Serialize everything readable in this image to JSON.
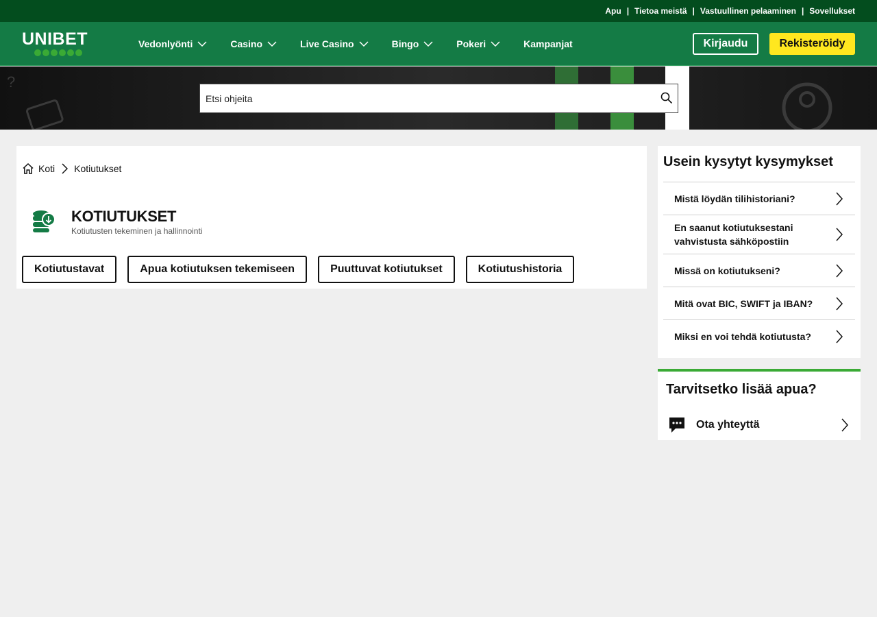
{
  "top_links": [
    "Apu",
    "Tietoa meistä",
    "Vastuullinen pelaaminen",
    "Sovellukset"
  ],
  "top_separator": "|",
  "logo": {
    "text": "UNIBET"
  },
  "nav": {
    "items": [
      {
        "label": "Vedonlyönti",
        "dropdown": true
      },
      {
        "label": "Casino",
        "dropdown": true
      },
      {
        "label": "Live Casino",
        "dropdown": true
      },
      {
        "label": "Bingo",
        "dropdown": true
      },
      {
        "label": "Pokeri",
        "dropdown": true
      },
      {
        "label": "Kampanjat",
        "dropdown": false
      }
    ],
    "login_label": "Kirjaudu",
    "register_label": "Rekisteröidy"
  },
  "search": {
    "placeholder": "Etsi ohjeita",
    "icon": "search-icon"
  },
  "breadcrumb": {
    "home": "Koti",
    "current": "Kotiutukset"
  },
  "page": {
    "title": "KOTIUTUKSET",
    "subtitle": "Kotiutusten tekeminen ja hallinnointi",
    "icon": "coins-download-icon"
  },
  "tabs": [
    "Kotiutustavat",
    "Apua kotiutuksen tekemiseen",
    "Puuttuvat kotiutukset",
    "Kotiutushistoria"
  ],
  "faq": {
    "title": "Usein kysytyt kysymykset",
    "items": [
      "Mistä löydän tilihistoriani?",
      "En saanut kotiutuksestani vahvistusta sähköpostiin",
      "Missä on kotiutukseni?",
      "Mitä ovat BIC, SWIFT ja IBAN?",
      "Miksi en voi tehdä kotiutusta?"
    ]
  },
  "help": {
    "title": "Tarvitsetko lisää apua?",
    "contact_label": "Ota yhteyttä",
    "icon": "chat-icon"
  },
  "colors": {
    "topbar": "#034d1e",
    "nav": "#147b45",
    "accent_green": "#3aaa35",
    "register_yellow": "#ffe71f",
    "page_bg": "#efefef"
  }
}
